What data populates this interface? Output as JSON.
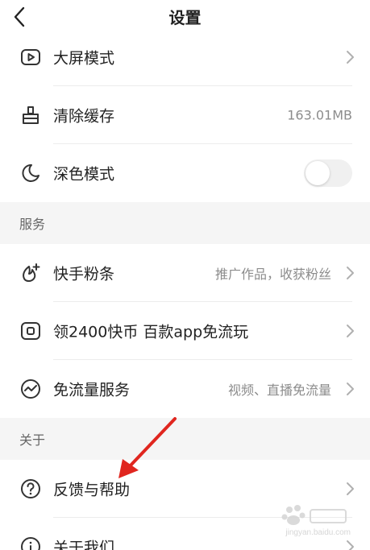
{
  "header": {
    "title": "设置",
    "back_icon": "chevron-left-icon"
  },
  "display": {
    "big_screen": {
      "label": "大屏模式",
      "icon": "play-screen-icon"
    },
    "clear_cache": {
      "label": "清除缓存",
      "value": "163.01MB",
      "icon": "broom-icon"
    },
    "dark_mode": {
      "label": "深色模式",
      "icon": "moon-icon",
      "enabled": false
    }
  },
  "services": {
    "title": "服务",
    "fans": {
      "label": "快手粉条",
      "hint": "推广作品，收获粉丝",
      "icon": "fan-boost-icon"
    },
    "coins": {
      "label": "领2400快币 百款app免流玩",
      "icon": "coin-card-icon"
    },
    "free_traffic": {
      "label": "免流量服务",
      "hint": "视频、直播免流量",
      "icon": "traffic-icon"
    }
  },
  "about": {
    "title": "关于",
    "feedback": {
      "label": "反馈与帮助",
      "icon": "question-icon"
    },
    "about_us": {
      "label": "关于我们",
      "icon": "info-icon"
    }
  },
  "annotation": {
    "arrow_color": "#e0261f"
  },
  "watermark": {
    "text": "jingyan.baidu.com"
  }
}
